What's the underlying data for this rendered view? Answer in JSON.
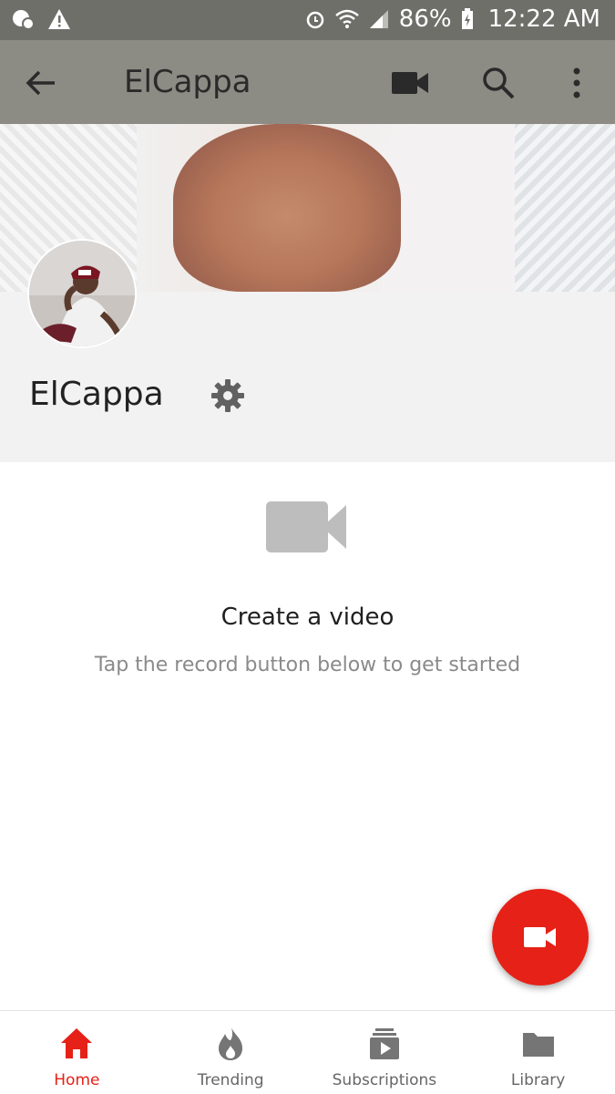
{
  "status_bar": {
    "battery_percent": "86%",
    "time": "12:22 AM",
    "icons": [
      "chat-bubble-icon",
      "warning-icon",
      "alarm-icon",
      "wifi-icon",
      "signal-icon",
      "battery-charging-icon"
    ]
  },
  "app_bar": {
    "title": "ElCappa",
    "icons": [
      "back-arrow-icon",
      "video-camera-icon",
      "search-icon",
      "more-vert-icon"
    ]
  },
  "profile": {
    "channel_name": "ElCappa",
    "settings_icon": "gear-icon"
  },
  "empty_state": {
    "icon": "video-camera-icon",
    "title": "Create a video",
    "subtitle": "Tap the record button below to get started"
  },
  "fab": {
    "icon": "video-camera-icon",
    "color": "#e62117"
  },
  "bottom_nav": {
    "items": [
      {
        "label": "Home",
        "icon": "home-icon",
        "active": true
      },
      {
        "label": "Trending",
        "icon": "flame-icon",
        "active": false
      },
      {
        "label": "Subscriptions",
        "icon": "subscriptions-icon",
        "active": false
      },
      {
        "label": "Library",
        "icon": "folder-icon",
        "active": false
      }
    ]
  },
  "colors": {
    "accent": "#e62117",
    "app_bar": "#8c8c85",
    "status_bar": "#6f6f6a"
  }
}
